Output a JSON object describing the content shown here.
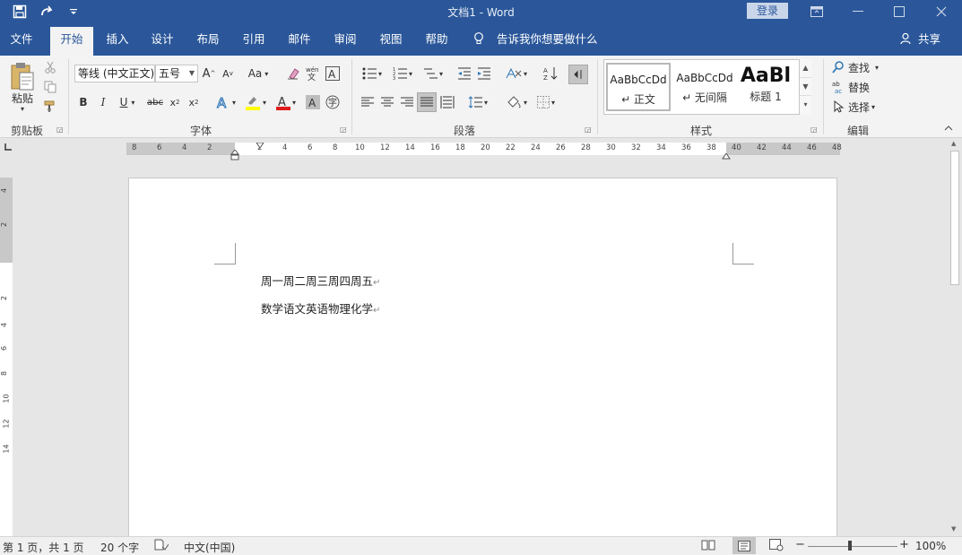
{
  "window": {
    "title": "文档1  -  Word",
    "login": "登录"
  },
  "qat": {
    "save_icon": "save-icon",
    "redo_icon": "redo-icon",
    "customize_icon": "customize-qat-icon"
  },
  "menu": {
    "tabs": [
      "文件",
      "开始",
      "插入",
      "设计",
      "布局",
      "引用",
      "邮件",
      "审阅",
      "视图",
      "帮助"
    ],
    "active": "开始",
    "tellme": "告诉我你想要做什么",
    "share": "共享"
  },
  "ribbon": {
    "clipboard": {
      "label": "剪贴板",
      "paste": "粘贴"
    },
    "font": {
      "label": "字体",
      "font_name": "等线 (中文正文)",
      "font_size": "五号",
      "change_case": "Aa"
    },
    "paragraph": {
      "label": "段落"
    },
    "styles": {
      "label": "样式",
      "items": [
        {
          "sample": "AaBbCcDd",
          "name": "↵ 正文"
        },
        {
          "sample": "AaBbCcDd",
          "name": "↵ 无间隔"
        },
        {
          "sample": "AaBl",
          "name": "标题 1"
        }
      ]
    },
    "editing": {
      "label": "编辑",
      "find": "查找",
      "replace": "替换",
      "select": "选择"
    }
  },
  "ruler": {
    "left_numbers": [
      "8",
      "6",
      "4",
      "2"
    ],
    "numbers": [
      "2",
      "4",
      "6",
      "8",
      "10",
      "12",
      "14",
      "16",
      "18",
      "20",
      "22",
      "24",
      "26",
      "28",
      "30",
      "32",
      "34",
      "36",
      "38",
      "40",
      "42",
      "44",
      "46",
      "48"
    ],
    "vertical_numbers": [
      "4",
      "2",
      "2",
      "4",
      "6",
      "8",
      "10",
      "12",
      "14"
    ]
  },
  "document": {
    "lines": [
      "周一周二周三周四周五",
      "数学语文英语物理化学"
    ],
    "paragraph_mark": "↵"
  },
  "status": {
    "page": "第 1 页，共 1 页",
    "words": "20 个字",
    "language": "中文(中国)",
    "zoom": "100%",
    "zoom_minus": "−",
    "zoom_plus": "+"
  }
}
